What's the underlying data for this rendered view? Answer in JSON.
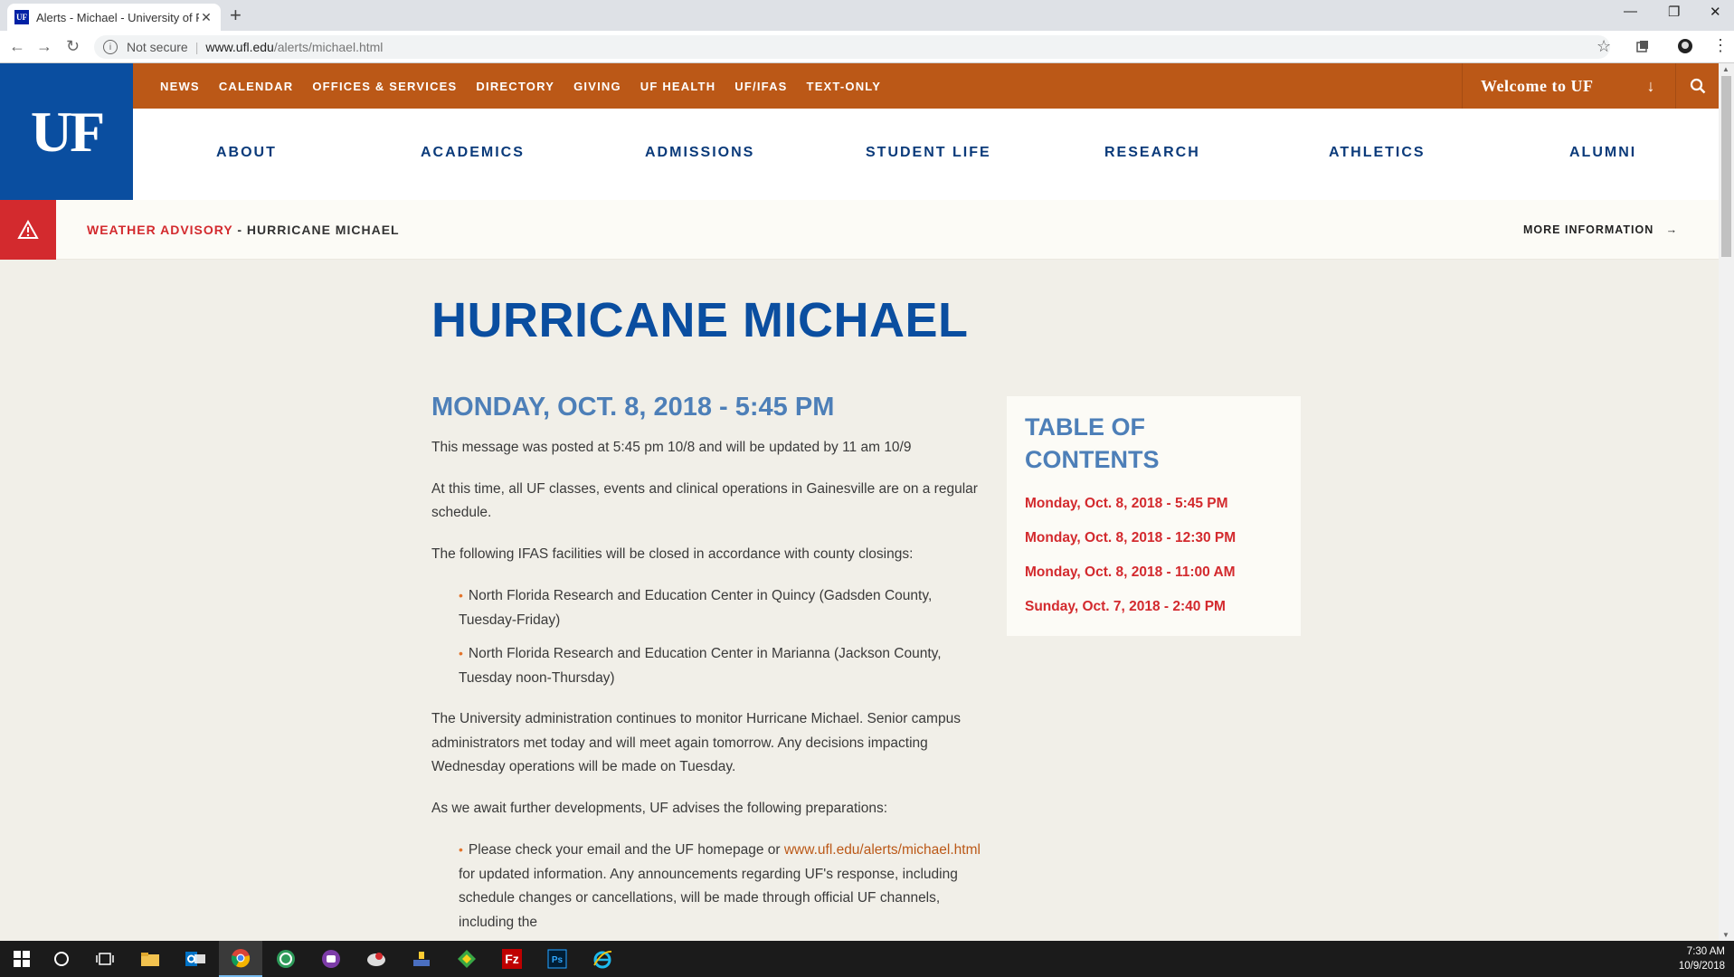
{
  "browser": {
    "tab_title": "Alerts - Michael - University of Fl",
    "favicon_text": "UF",
    "security": "Not secure",
    "url_host": "www.ufl.edu",
    "url_path": "/alerts/michael.html"
  },
  "site": {
    "logo": "UF",
    "top_links": [
      "NEWS",
      "CALENDAR",
      "OFFICES & SERVICES",
      "DIRECTORY",
      "GIVING",
      "UF HEALTH",
      "UF/IFAS",
      "TEXT-ONLY"
    ],
    "welcome": "Welcome to UF",
    "main_nav": [
      "ABOUT",
      "ACADEMICS",
      "ADMISSIONS",
      "STUDENT LIFE",
      "RESEARCH",
      "ATHLETICS",
      "ALUMNI"
    ]
  },
  "alert": {
    "label": "WEATHER ADVISORY",
    "separator": " - ",
    "title": "HURRICANE MICHAEL",
    "more": "MORE INFORMATION"
  },
  "page": {
    "title": "HURRICANE MICHAEL",
    "section_heading": "MONDAY, OCT. 8, 2018 - 5:45 PM",
    "p1": "This message was posted at 5:45 pm 10/8 and will be updated by 11 am 10/9",
    "p2": "At this time, all UF classes, events and clinical operations in Gainesville are on a regular schedule.",
    "p3": "The following IFAS facilities will be closed in accordance with county closings:",
    "list1": [
      "North Florida Research and Education Center in Quincy (Gadsden County, Tuesday-Friday)",
      "North Florida Research and Education Center in Marianna (Jackson County, Tuesday noon-Thursday)"
    ],
    "p4": "The University administration continues to monitor Hurricane Michael. Senior campus administrators met today and will meet again tomorrow. Any decisions impacting Wednesday operations will be made on Tuesday.",
    "p5": "As we await further developments, UF advises the following preparations:",
    "list2_pre": "Please check your email and the UF homepage or",
    "list2_link": "www.ufl.edu/alerts/michael.html",
    "list2_post": "for updated information. Any announcements regarding UF's response, including schedule changes or cancellations, will be made through official UF channels, including the"
  },
  "toc": {
    "title": "TABLE OF CONTENTS",
    "items": [
      "Monday, Oct. 8, 2018 - 5:45 PM",
      "Monday, Oct. 8, 2018 - 12:30 PM",
      "Monday, Oct. 8, 2018 - 11:00 AM",
      "Sunday, Oct. 7, 2018 - 2:40 PM"
    ]
  },
  "taskbar": {
    "time": "7:30 AM",
    "date": "10/9/2018"
  },
  "colors": {
    "uf_blue": "#0a4ea0",
    "uf_orange": "#bb5817",
    "alert_red": "#d32a2e"
  }
}
